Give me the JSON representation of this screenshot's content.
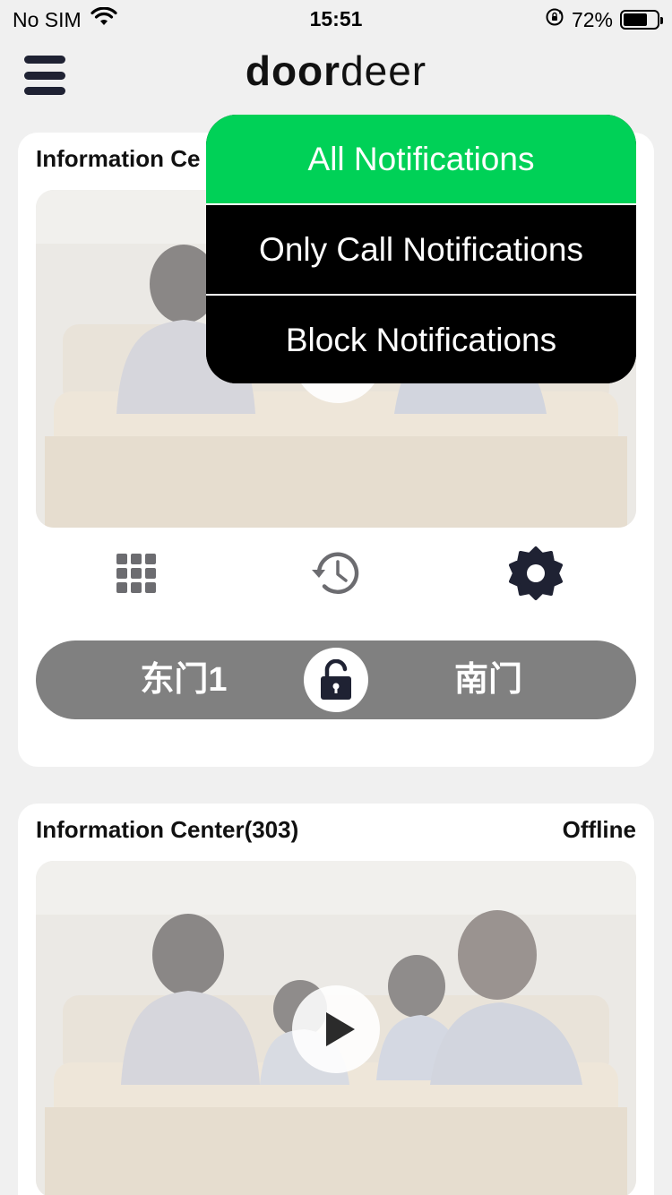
{
  "status_bar": {
    "carrier": "No SIM",
    "time": "15:51",
    "battery_percent": "72%",
    "battery_level": 0.72
  },
  "header": {
    "logo_bold": "door",
    "logo_light": "deer"
  },
  "devices": [
    {
      "title": "Information Ce",
      "status": "",
      "doors": {
        "left": "东门1",
        "right": "南门"
      }
    },
    {
      "title": "Information Center(303)",
      "status": "Offline"
    }
  ],
  "actions": {
    "keypad_icon": "keypad-icon",
    "history_icon": "history-icon",
    "settings_icon": "gear-icon",
    "unlock_icon": "unlock-icon"
  },
  "notification_menu": {
    "items": [
      {
        "label": "All Notifications",
        "selected": true
      },
      {
        "label": "Only Call Notifications",
        "selected": false
      },
      {
        "label": "Block Notifications",
        "selected": false
      }
    ]
  },
  "colors": {
    "selected_option": "#00d157",
    "menu_background": "#000000",
    "door_bar": "#808080",
    "page_background": "#f0f0f0"
  }
}
